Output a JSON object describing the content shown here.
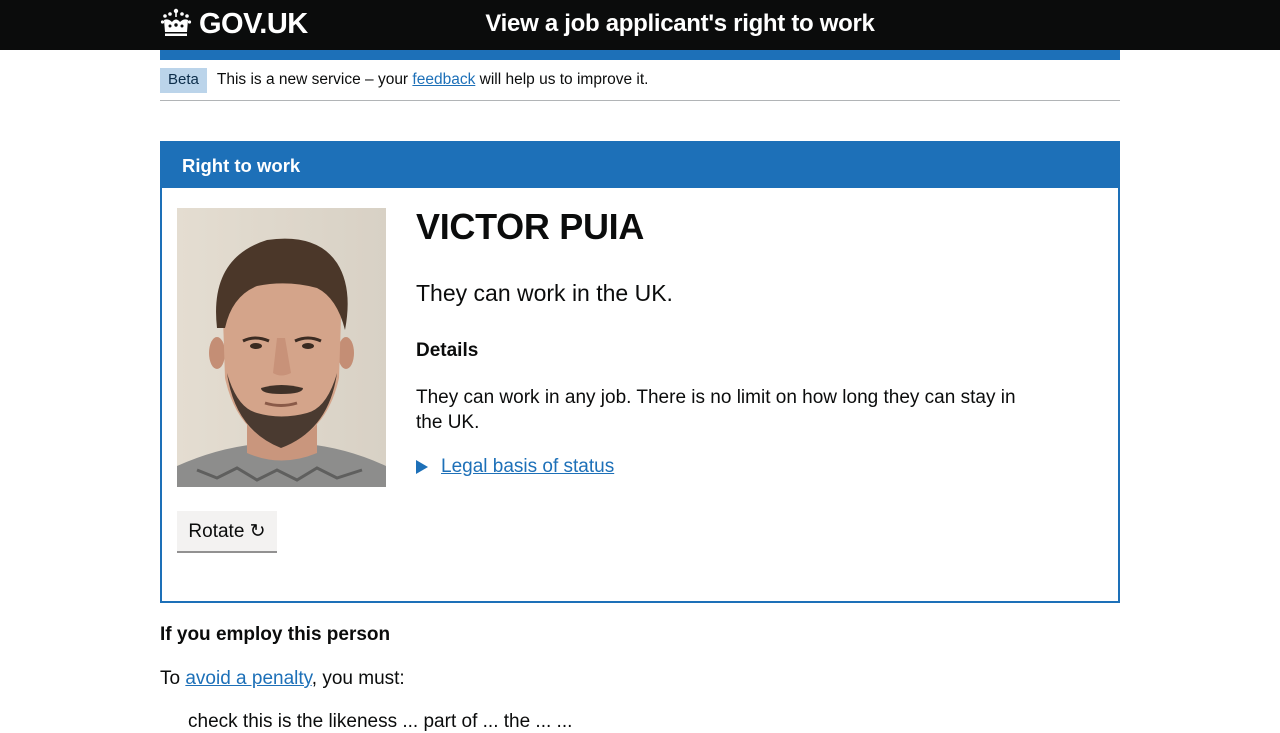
{
  "header": {
    "logo_text": "GOV.UK",
    "logo_icon": "crown-icon",
    "service_name": "View a job applicant's right to work"
  },
  "phase_banner": {
    "tag": "Beta",
    "text_before": "This is a new service – your ",
    "link": "feedback",
    "text_after": " will help us to improve it."
  },
  "panel": {
    "title": "Right to work",
    "photo_icon": "applicant-photo",
    "rotate_label": "Rotate ↻",
    "name": "VICTOR PUIA",
    "status": "They can work in the UK.",
    "details_heading": "Details",
    "details_text": "They can work in any job. There is no limit on how long they can stay in the UK.",
    "legal_basis_label": "Legal basis of status"
  },
  "employ": {
    "heading": "If you employ this person",
    "to_text": "To ",
    "penalty_link": "avoid a penalty",
    "must_text": ", you must:",
    "first_item_partial": "check this is the likeness   ...   part of   ...   the ...   ..."
  },
  "colors": {
    "header_bg": "#0b0c0c",
    "brand_blue": "#1d70b8",
    "tag_bg": "#bbd4ea",
    "button_bg": "#f3f2f1"
  }
}
